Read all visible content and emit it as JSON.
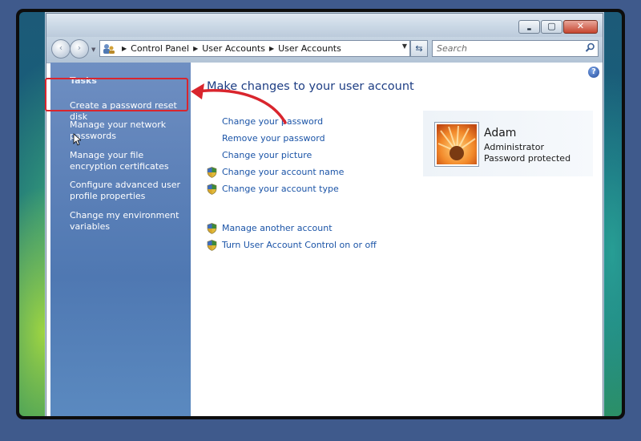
{
  "window": {
    "controls": {
      "minimize_glyph": "▬",
      "maximize_glyph": "▢",
      "close_glyph": "✕"
    }
  },
  "navbar": {
    "back_glyph": "‹",
    "forward_glyph": "›",
    "breadcrumbs": [
      "Control Panel",
      "User Accounts",
      "User Accounts"
    ],
    "search_placeholder": "Search"
  },
  "sidebar": {
    "title": "Tasks",
    "items": [
      {
        "label": "Create a password reset disk"
      },
      {
        "label": "Manage your network passwords"
      },
      {
        "label": "Manage your file encryption certificates"
      },
      {
        "label": "Configure advanced user profile properties"
      },
      {
        "label": "Change my environment variables"
      }
    ]
  },
  "main": {
    "heading": "Make changes to your user account",
    "links": [
      {
        "label": "Change your password"
      },
      {
        "label": "Remove your password"
      },
      {
        "label": "Change your picture"
      },
      {
        "label": "Change your account name"
      },
      {
        "label": "Change your account type"
      },
      {
        "label": "Manage another account"
      },
      {
        "label": "Turn User Account Control on or off"
      }
    ]
  },
  "user": {
    "name": "Adam",
    "role": "Administrator",
    "status": "Password protected"
  },
  "colors": {
    "annotation": "#d9252d",
    "link": "#1b54a7",
    "heading": "#1e3e84"
  }
}
